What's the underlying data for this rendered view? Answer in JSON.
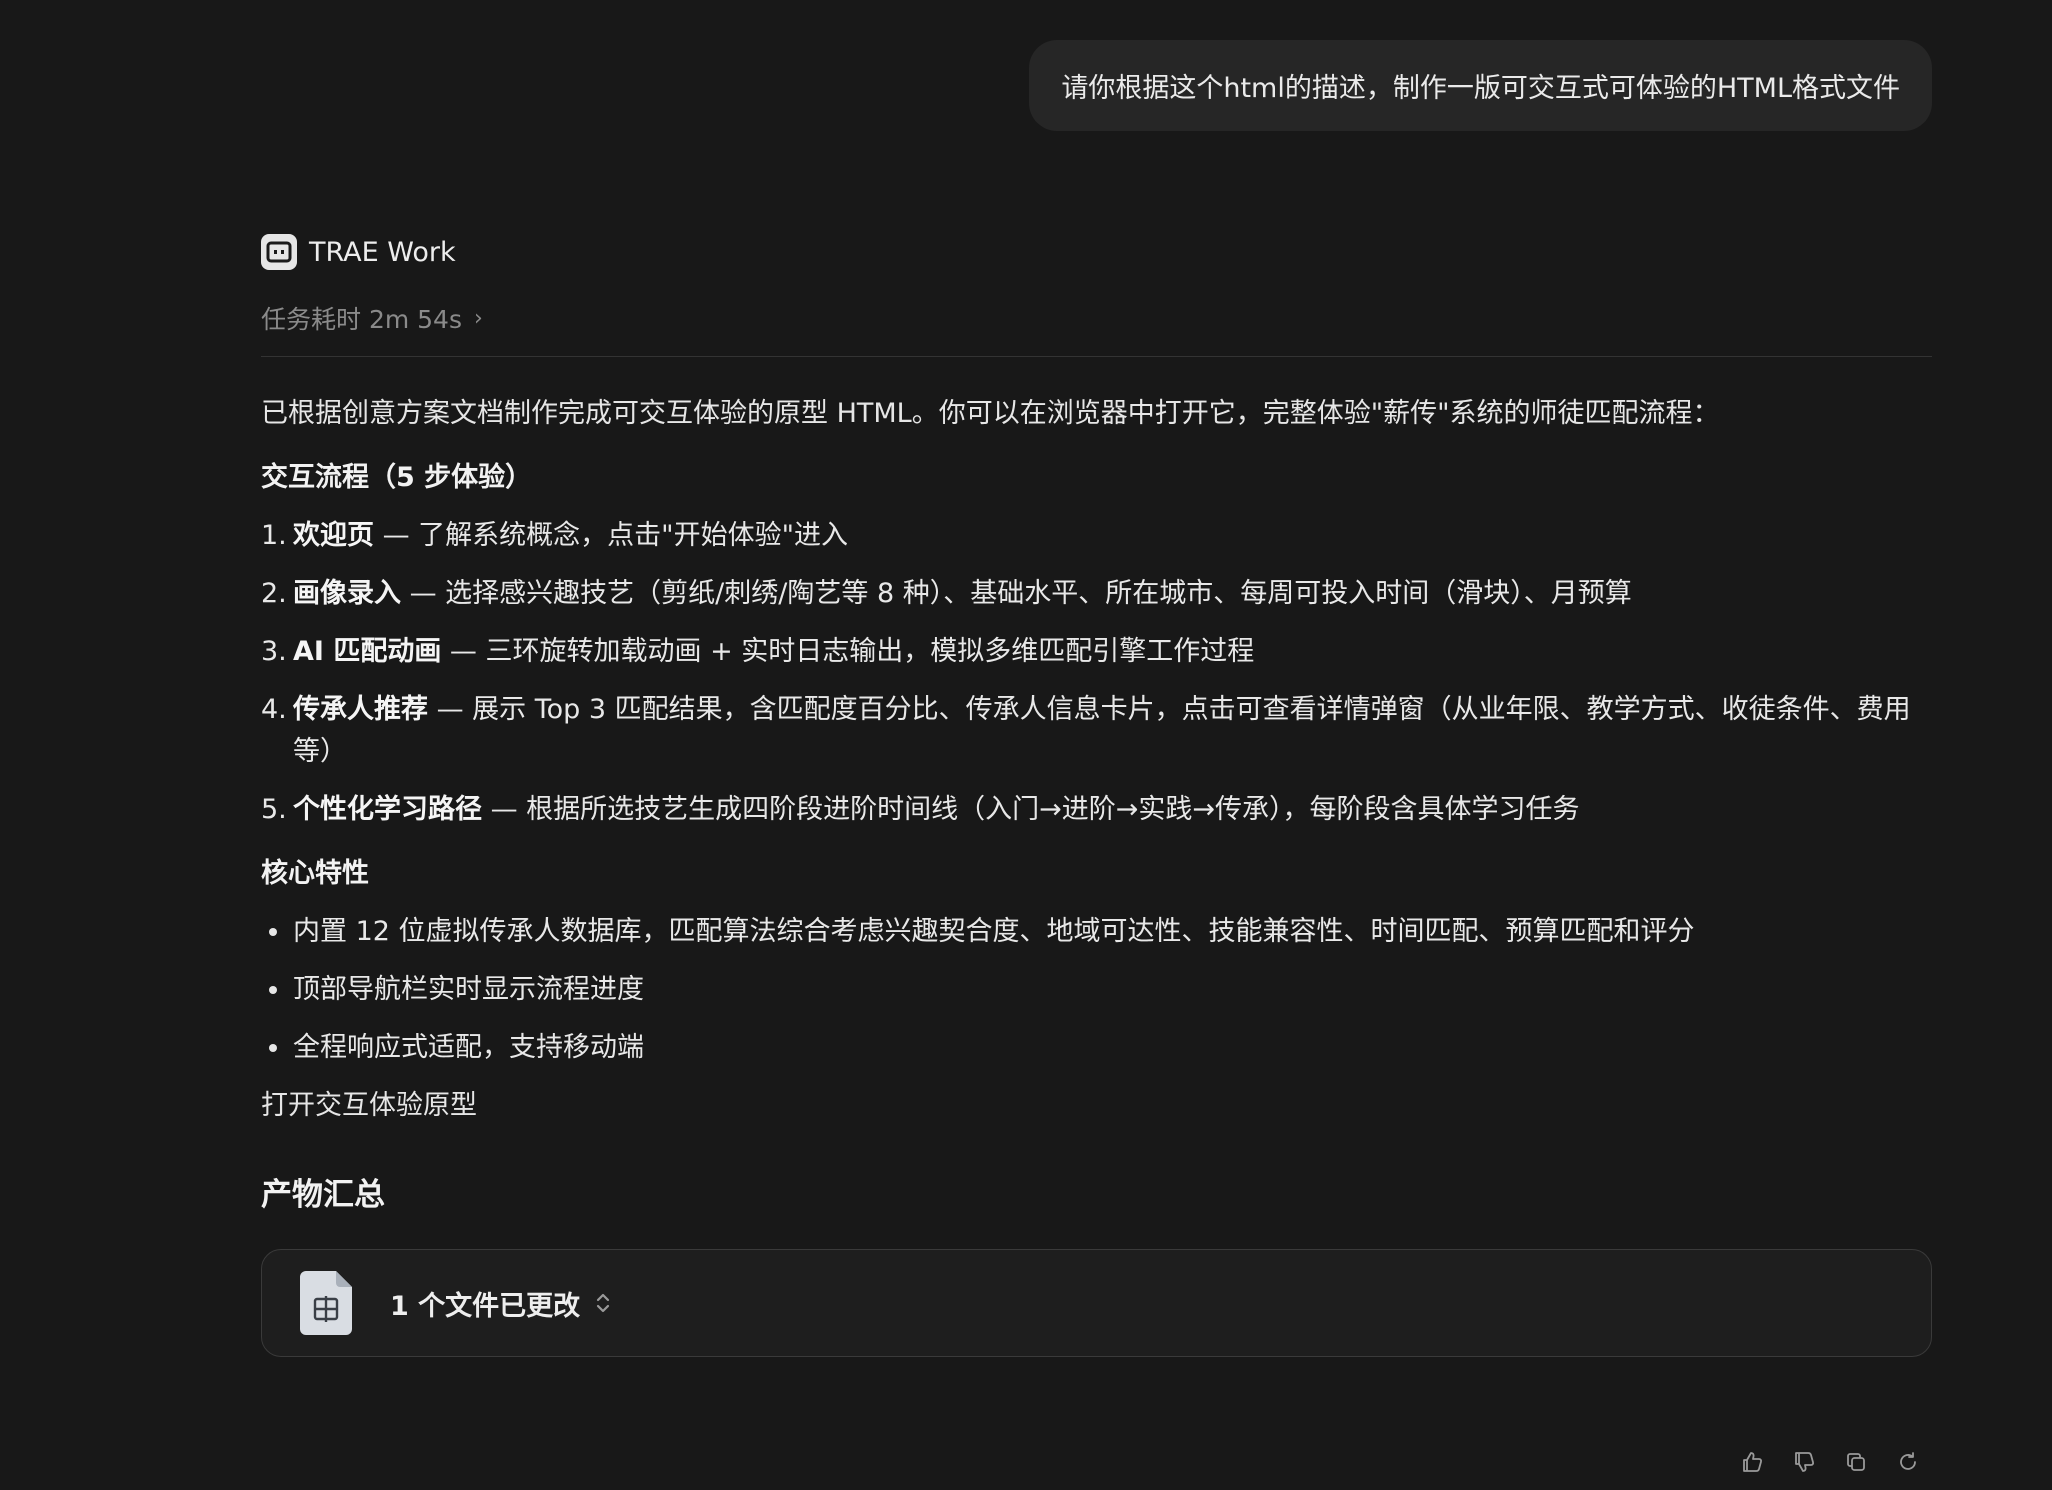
{
  "user_message": "请你根据这个html的描述，制作一版可交互式可体验的HTML格式文件",
  "agent": {
    "name": "TRAE Work",
    "task_time": "任务耗时 2m 54s",
    "task_time_chevron": "›"
  },
  "intro": "已根据创意方案文档制作完成可交互体验的原型 HTML。你可以在浏览器中打开它，完整体验\"薪传\"系统的师徒匹配流程：",
  "flow": {
    "heading": "交互流程（5 步体验）",
    "steps": [
      {
        "num": "1.",
        "title": "欢迎页",
        "desc": " — 了解系统概念，点击\"开始体验\"进入"
      },
      {
        "num": "2.",
        "title": "画像录入",
        "desc": " — 选择感兴趣技艺（剪纸/刺绣/陶艺等 8 种）、基础水平、所在城市、每周可投入时间（滑块）、月预算"
      },
      {
        "num": "3.",
        "title": "AI 匹配动画",
        "desc": " — 三环旋转加载动画 + 实时日志输出，模拟多维匹配引擎工作过程"
      },
      {
        "num": "4.",
        "title": "传承人推荐",
        "desc": " — 展示 Top 3 匹配结果，含匹配度百分比、传承人信息卡片，点击可查看详情弹窗（从业年限、教学方式、收徒条件、费用等）"
      },
      {
        "num": "5.",
        "title": "个性化学习路径",
        "desc": " — 根据所选技艺生成四阶段进阶时间线（入门→进阶→实践→传承），每阶段含具体学习任务"
      }
    ]
  },
  "features": {
    "heading": "核心特性",
    "items": [
      "内置 12 位虚拟传承人数据库，匹配算法综合考虑兴趣契合度、地域可达性、技能兼容性、时间匹配、预算匹配和评分",
      "顶部导航栏实时显示流程进度",
      "全程响应式适配，支持移动端"
    ]
  },
  "open_link": "打开交互体验原型",
  "summary": {
    "title": "产物汇总",
    "file_label": "1 个文件已更改"
  },
  "actions": [
    "thumbs-up-icon",
    "thumbs-down-icon",
    "copy-icon",
    "refresh-icon"
  ]
}
